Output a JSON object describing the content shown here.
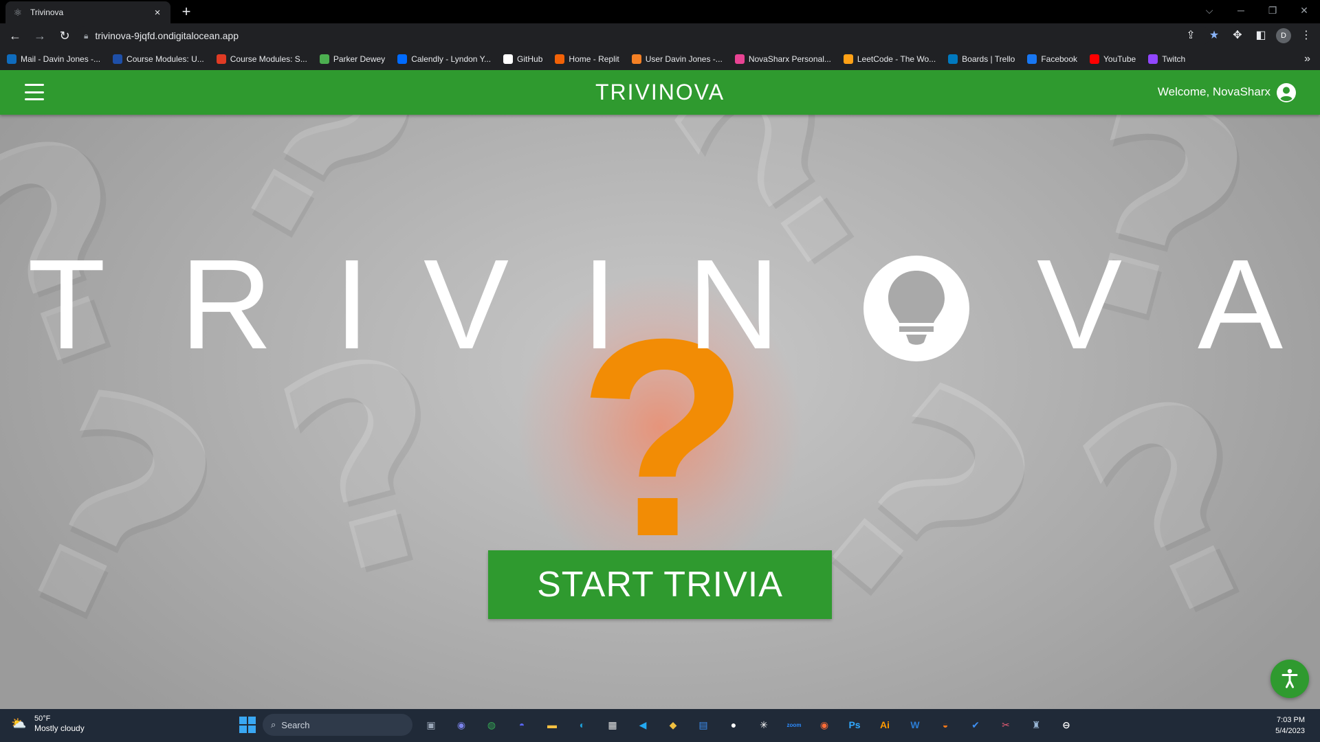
{
  "browser": {
    "tab_title": "Trivinova",
    "tab_close": "×",
    "new_tab": "+",
    "url": "trivinova-9jqfd.ondigitalocean.app",
    "profile_initial": "D",
    "window_controls": [
      "⌵",
      "─",
      "❐",
      "✕"
    ],
    "bookmarks": [
      {
        "label": "Mail - Davin Jones -...",
        "color": "#0f6cbd"
      },
      {
        "label": "Course Modules: U...",
        "color": "#1e4fa8"
      },
      {
        "label": "Course Modules: S...",
        "color": "#e03b24"
      },
      {
        "label": "Parker Dewey",
        "color": "#4caf50"
      },
      {
        "label": "Calendly - Lyndon Y...",
        "color": "#006bff"
      },
      {
        "label": "GitHub",
        "color": "#ffffff"
      },
      {
        "label": "Home - Replit",
        "color": "#f26207"
      },
      {
        "label": "User Davin Jones -...",
        "color": "#f48024"
      },
      {
        "label": "NovaSharx Personal...",
        "color": "#e84393"
      },
      {
        "label": "LeetCode - The Wo...",
        "color": "#ffa116"
      },
      {
        "label": "Boards | Trello",
        "color": "#0079bf"
      },
      {
        "label": "Facebook",
        "color": "#1877f2"
      },
      {
        "label": "YouTube",
        "color": "#ff0000"
      },
      {
        "label": "Twitch",
        "color": "#9146ff"
      }
    ],
    "bookmarks_more": "»"
  },
  "appbar": {
    "brand": "TRIVINOVA",
    "welcome": "Welcome, NovaSharx",
    "accent": "#2f9a2f"
  },
  "hero": {
    "letters": [
      "T",
      "R",
      "I",
      "V",
      "I",
      "N",
      "V",
      "A"
    ],
    "question_mark": "?"
  },
  "start_button": "START TRIVIA",
  "taskbar": {
    "temperature": "50°F",
    "condition": "Mostly cloudy",
    "search_placeholder": "Search",
    "time": "7:03 PM",
    "date": "5/4/2023",
    "apps": [
      {
        "name": "task-view",
        "glyph": "▣",
        "color": "#9aa7b8"
      },
      {
        "name": "teams-chat",
        "glyph": "◉",
        "color": "#7b83eb"
      },
      {
        "name": "chrome",
        "glyph": "◍",
        "color": "#34a853"
      },
      {
        "name": "discord",
        "glyph": "◓",
        "color": "#5865f2"
      },
      {
        "name": "file-explorer",
        "glyph": "▬",
        "color": "#f6c142"
      },
      {
        "name": "edge",
        "glyph": "◐",
        "color": "#1fa0d8"
      },
      {
        "name": "store",
        "glyph": "▦",
        "color": "#e6e6e6"
      },
      {
        "name": "vscode",
        "glyph": "◀",
        "color": "#23a9f2"
      },
      {
        "name": "git",
        "glyph": "◆",
        "color": "#f0c040"
      },
      {
        "name": "calendar",
        "glyph": "▤",
        "color": "#3d8ef0"
      },
      {
        "name": "mongodb-compass",
        "glyph": "●",
        "color": "#ffffff"
      },
      {
        "name": "slack",
        "glyph": "✳",
        "color": "#ffffff"
      },
      {
        "name": "zoom",
        "glyph": "zoom",
        "color": "#2d8cff"
      },
      {
        "name": "postman",
        "glyph": "◉",
        "color": "#ff6c37"
      },
      {
        "name": "photoshop",
        "glyph": "Ps",
        "color": "#31a8ff"
      },
      {
        "name": "illustrator",
        "glyph": "Ai",
        "color": "#ff9a00"
      },
      {
        "name": "word",
        "glyph": "W",
        "color": "#2b7cd3"
      },
      {
        "name": "app-orange",
        "glyph": "◒",
        "color": "#ff7a18"
      },
      {
        "name": "todo",
        "glyph": "✔",
        "color": "#3d8ef0"
      },
      {
        "name": "snipping-tool",
        "glyph": "✂",
        "color": "#e85d75"
      },
      {
        "name": "pgadmin",
        "glyph": "♜",
        "color": "#9ab8d8"
      },
      {
        "name": "app-circle",
        "glyph": "⊖",
        "color": "#ffffff"
      }
    ]
  }
}
